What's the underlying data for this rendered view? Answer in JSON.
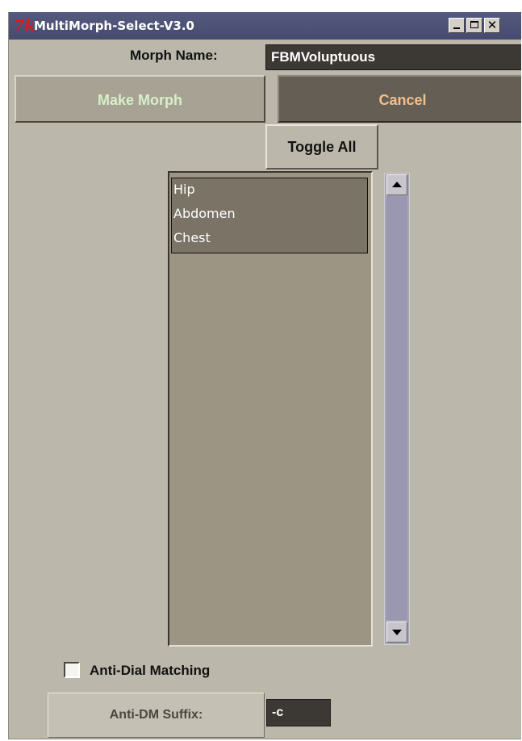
{
  "window": {
    "title": "MultiMorph-Select-V3.0",
    "icon_glyph": "7k",
    "icon_name": "tk-feather-icon",
    "controls": {
      "minimize": "minimize-icon",
      "maximize": "maximize-icon",
      "close_glyph": "✕",
      "close": "close-icon"
    }
  },
  "morph": {
    "label": "Morph Name:",
    "value": "FBMVoluptuous"
  },
  "buttons": {
    "make_morph": "Make Morph",
    "cancel": "Cancel",
    "toggle_all": "Toggle All"
  },
  "list": {
    "items": [
      "Hip",
      "Abdomen",
      "Chest"
    ],
    "selected": [
      "Hip",
      "Abdomen",
      "Chest"
    ]
  },
  "scrollbar": {
    "up": "scroll-up-arrow-icon",
    "down": "scroll-down-arrow-icon"
  },
  "anti_dial": {
    "label": "Anti-Dial Matching",
    "checked": false
  },
  "suffix": {
    "label": "Anti-DM Suffix:",
    "value": "-c"
  },
  "colors": {
    "window_bg": "#bbb7ab",
    "titlebar": "#4a4f73",
    "make_morph_text": "#d6f0c8",
    "cancel_bg": "#645e55",
    "cancel_text": "#f4c08a",
    "list_bg": "#9c9584",
    "list_selection": "#7a7366",
    "input_bg": "#3c3834"
  }
}
